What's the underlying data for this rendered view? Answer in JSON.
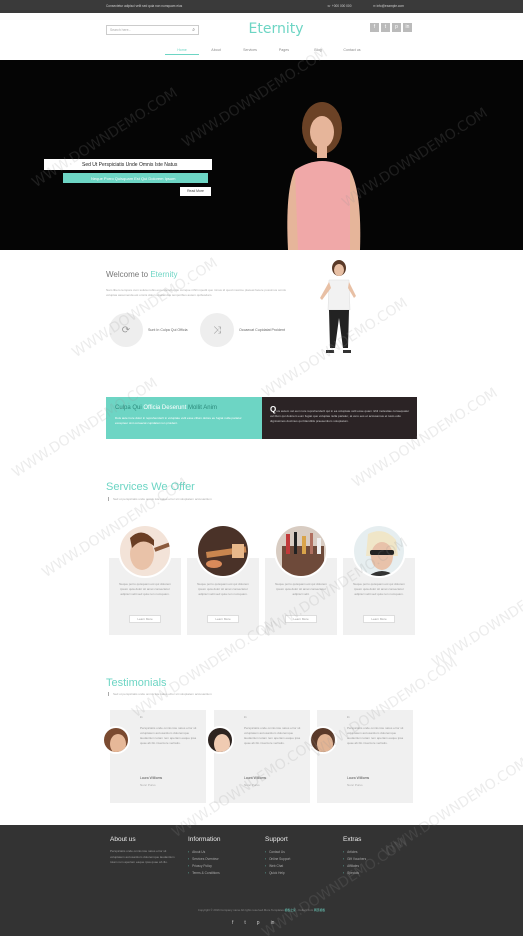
{
  "topbar": {
    "tagline": "Consectetur adipisci velit sed quia non numquam eius",
    "phone": "+000 000 000",
    "email": "info@example.com"
  },
  "header": {
    "search_placeholder": "Search here...",
    "brand": "Eternity",
    "social_icons": [
      "facebook-icon",
      "twitter-icon",
      "pinterest-icon",
      "linkedin-icon"
    ]
  },
  "nav": [
    "Home",
    "About",
    "Services",
    "Pages",
    "Blog",
    "Contact us"
  ],
  "hero": {
    "caption1": "Sed Ut Perspiciatis Unde Omnis Iste Natus",
    "caption2": "Neque Porro Quisquam Est Qui Dolorem Ipsum",
    "button": "Read More"
  },
  "welcome": {
    "title_prefix": "Welcome to",
    "title_brand": "Eternity",
    "text": "Nam libero tempore cum soluta nobis est eligendi optio cumque nihil impedit quo minus id quod maxime placeat facere possimus omnis voluptas assumenda est omnis dolor repellendus temporibus autem quibusdam.",
    "features": [
      {
        "icon": "refresh-icon",
        "label": "Sunt In Culpa Qui Officia"
      },
      {
        "icon": "shuffle-icon",
        "label": "Occaecat Cupidatat Proident"
      }
    ]
  },
  "band": {
    "title_part1": "Culpa Qui",
    "title_part2": "Officia Deserunt",
    "title_part3": "Mollit Anim",
    "left_text": "Duis aute irure dolor in reprehenderit in voluptate velit esse cillum dolore eu fugiat nulla pariatur excepteur sint occaecat cupidatat non proident.",
    "right_initial": "Q",
    "right_text": "uis autem vel eum iure reprehenderit qui in ea voluptate velit esse quam nihil molestiae consequatur vel illum qui dolorem eum fugiat quo voluptas nulla pariatur, at vero eos et accusamus et iusto odio dignissimos ducimus qui blanditiis praesentium voluptatum."
  },
  "services": {
    "title": "Services We Offer",
    "subtitle": "Sed ut perspiciatis unde omnis iste natus error sit voluptatem accusantium",
    "cards": [
      {
        "text": "Neque porro quisquam est qui dolorem ipsum quia dolor sit amet consectetur adipisci velit sed quia non numquam.",
        "button": "Learn More"
      },
      {
        "text": "Neque porro quisquam est qui dolorem ipsum quia dolor sit amet consectetur adipisci velit sed quia non numquam.",
        "button": "Learn More"
      },
      {
        "text": "Neque porro quisquam est qui dolorem ipsum quia dolor sit amet consectetur adipisci velit.",
        "button": "Learn More"
      },
      {
        "text": "Neque porro quisquam est qui dolorem ipsum quia dolor sit amet consectetur adipisci velit sed quia non numquam.",
        "button": "Learn More"
      }
    ]
  },
  "testimonials": {
    "title": "Testimonials",
    "subtitle": "Sed ut perspiciatis unde omnis iste natus error sit voluptatem accusantium",
    "items": [
      {
        "quote": "Perspiciatis unde omnis iste natus error sit voluptatem accusantium doloremque laudantium totam rem aperiam eaque ipsa quae ab illo inventore veritatis.",
        "name": "Laura Williams",
        "role": "Nunc Purus"
      },
      {
        "quote": "Perspiciatis unde omnis iste natus error sit voluptatem accusantium doloremque laudantium totam rem aperiam eaque ipsa quae ab illo inventore veritatis.",
        "name": "Laura Williams",
        "role": "Nunc Purus"
      },
      {
        "quote": "Perspiciatis unde omnis iste natus error sit voluptatem accusantium doloremque laudantium totam rem aperiam eaque ipsa quae ab illo inventore veritatis.",
        "name": "Laura Williams",
        "role": "Nunc Purus"
      }
    ]
  },
  "footer": {
    "about_title": "About us",
    "about_text": "Perspiciatis unde omnis iste natus error sit voluptatem accusantium doloremque laudantium totam rem aperiam eaque ipsa quae ab illo.",
    "info_title": "Information",
    "info_items": [
      "About Us",
      "Services Overview",
      "Privacy Policy",
      "Terms & Conditions"
    ],
    "support_title": "Support",
    "support_items": [
      "Contact Us",
      "Online Support",
      "Web Chat",
      "Quick Help"
    ],
    "extras_title": "Extras",
    "extras_items": [
      "Articles",
      "Gift Vouchers",
      "Affiliates",
      "Specials"
    ],
    "copyright_prefix": "Copyright © 2016 Company name All rights reserved.More Templates",
    "copyright_link1": "模板之家",
    "copyright_mid": "- Collect from",
    "copyright_link2": "网页模板",
    "social_icons": [
      "facebook-icon",
      "twitter-icon",
      "pinterest-icon",
      "linkedin-icon"
    ]
  },
  "watermark": "WWW.DOWNDEMO.COM",
  "colors": {
    "accent": "#6dd5c4",
    "dark": "#333333",
    "band_dark": "#2b2325"
  }
}
